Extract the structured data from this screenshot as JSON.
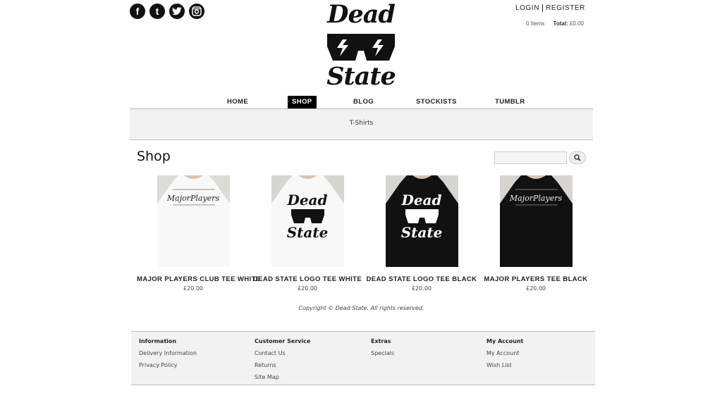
{
  "header": {
    "social": [
      "facebook-icon",
      "tumblr-icon",
      "twitter-icon",
      "instagram-icon"
    ],
    "login_label": "LOGIN",
    "register_label": "REGISTER",
    "cart_items": "0 Items",
    "cart_total_label": "Total:",
    "cart_total_value": "£0.00"
  },
  "logo": {
    "line1": "Dead",
    "line2": "State"
  },
  "nav": {
    "items": [
      {
        "label": "HOME"
      },
      {
        "label": "SHOP"
      },
      {
        "label": "BLOG"
      },
      {
        "label": "STOCKISTS"
      },
      {
        "label": "TUMBLR"
      }
    ],
    "active": "SHOP"
  },
  "subnav": {
    "label": "T-Shirts"
  },
  "main": {
    "title": "Shop",
    "search": {
      "value": "",
      "placeholder": ""
    }
  },
  "products": [
    {
      "name": "MAJOR PLAYERS CLUB TEE WHITE",
      "price": "£20.00",
      "shirt_color": "#ffffff"
    },
    {
      "name": "DEAD STATE LOGO TEE WHITE",
      "price": "£20.00",
      "shirt_color": "#ffffff"
    },
    {
      "name": "DEAD STATE LOGO TEE BLACK",
      "price": "£20.00",
      "shirt_color": "#111111"
    },
    {
      "name": "MAJOR PLAYERS TEE BLACK",
      "price": "£20.00",
      "shirt_color": "#111111"
    }
  ],
  "copyright": "Copyright © Dead State. All rights reserved.",
  "footer": {
    "columns": [
      {
        "heading": "Information",
        "links": [
          "Delivery Information",
          "Privacy Policy"
        ]
      },
      {
        "heading": "Customer Service",
        "links": [
          "Contact Us",
          "Returns",
          "Site Map"
        ]
      },
      {
        "heading": "Extras",
        "links": [
          "Specials"
        ]
      },
      {
        "heading": "My Account",
        "links": [
          "My Account",
          "Wish List"
        ]
      }
    ]
  }
}
